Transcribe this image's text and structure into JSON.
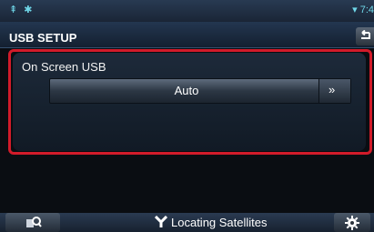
{
  "status": {
    "left_icons": [
      "usb-icon",
      "bluetooth-icon"
    ],
    "right_icons": [
      "wifi-icon"
    ],
    "time_partial": "7:4"
  },
  "header": {
    "title": "USB SETUP",
    "back_icon": "back-arrow-icon"
  },
  "setting": {
    "label": "On Screen USB",
    "value": "Auto",
    "next_label": "»"
  },
  "footer": {
    "left_icon": "search-icon",
    "nav_icon": "signal-antenna-icon",
    "nav_status": "Locating Satellites",
    "right_icon": "gear-icon"
  },
  "colors": {
    "highlight": "#d21b2a",
    "accent": "#6fd7e8"
  }
}
